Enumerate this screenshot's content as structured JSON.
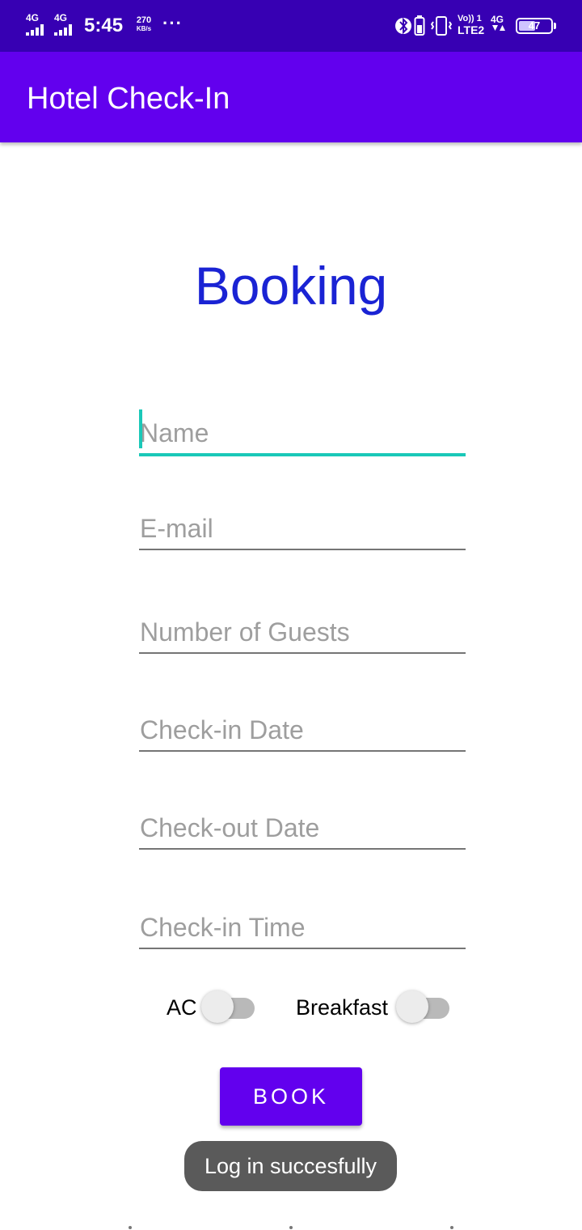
{
  "status_bar": {
    "sim1_label": "4G",
    "sim2_label": "4G",
    "time": "5:45",
    "net_speed_value": "270",
    "net_speed_unit": "KB/s",
    "more": "···",
    "volte_label": "Vo)) 1",
    "lte_label": "LTE2",
    "net_label": "4G",
    "battery": "47",
    "icons": [
      "signal-icon",
      "bluetooth-icon",
      "battery-saver-icon",
      "vibrate-icon",
      "data-arrows-icon",
      "battery-icon"
    ]
  },
  "app_bar": {
    "title": "Hotel Check-In"
  },
  "main": {
    "heading": "Booking",
    "fields": {
      "name": {
        "placeholder": "Name",
        "value": ""
      },
      "email": {
        "placeholder": "E-mail",
        "value": ""
      },
      "guests": {
        "placeholder": "Number of Guests",
        "value": ""
      },
      "checkin_date": {
        "placeholder": "Check-in Date",
        "value": ""
      },
      "checkout_date": {
        "placeholder": "Check-out Date",
        "value": ""
      },
      "checkin_time": {
        "placeholder": "Check-in Time",
        "value": ""
      }
    },
    "switches": {
      "ac": {
        "label": "AC",
        "checked": false
      },
      "breakfast": {
        "label": "Breakfast",
        "checked": false
      }
    },
    "book_button": "BOOK"
  },
  "toast": {
    "message": "Log in succesfully"
  },
  "colors": {
    "status_bar": "#3700b3",
    "primary": "#6200ee",
    "heading": "#1a23d4",
    "accent": "#1ac8b8",
    "toast_bg": "#5a5a5a"
  }
}
